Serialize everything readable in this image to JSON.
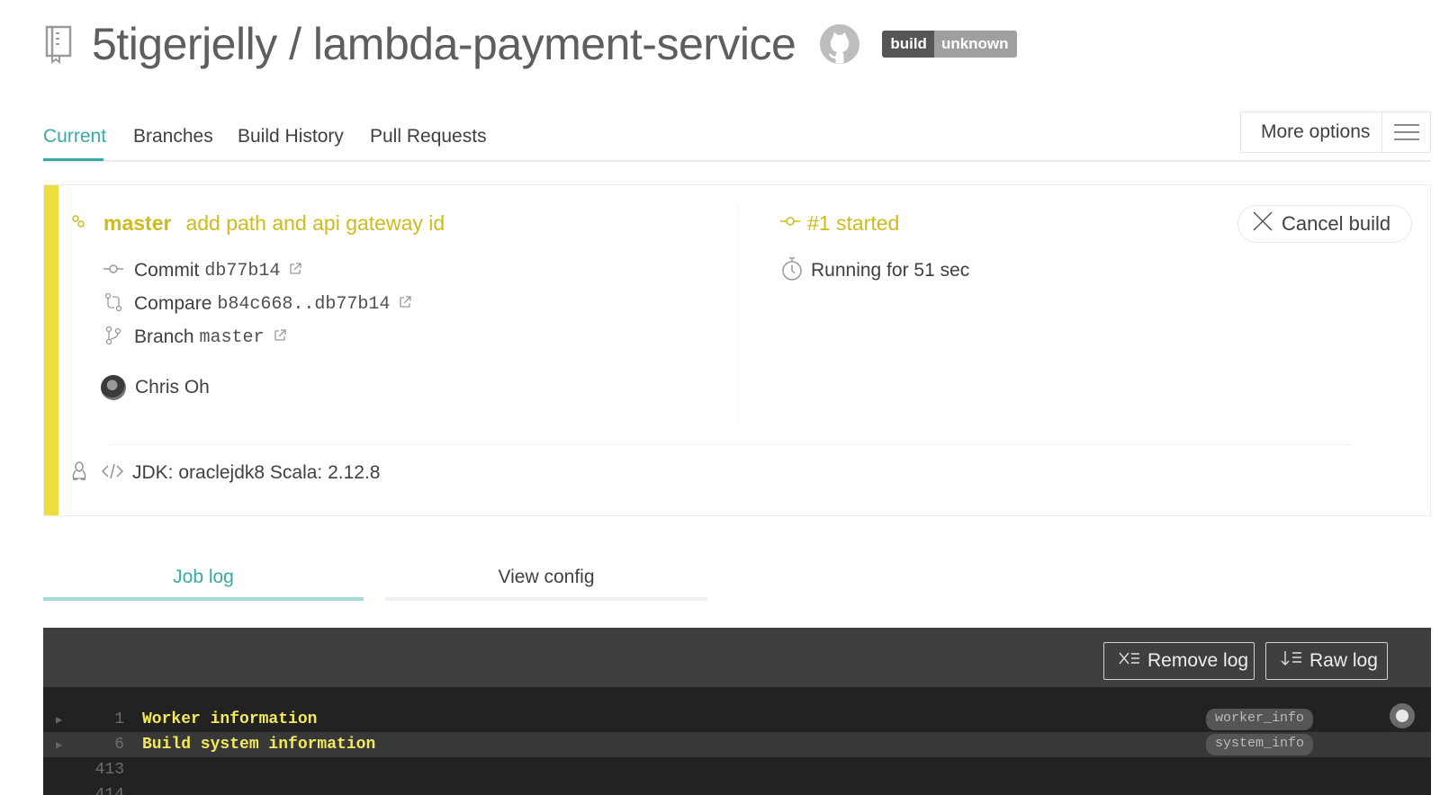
{
  "header": {
    "repo_title": "5tigerjelly / lambda-payment-service",
    "badge_left": "build",
    "badge_right": "unknown"
  },
  "nav": {
    "tabs": [
      "Current",
      "Branches",
      "Build History",
      "Pull Requests"
    ],
    "active_tab": "Current",
    "more_options": "More options"
  },
  "build": {
    "branch": "master",
    "commit_message": "add path and api gateway id",
    "status": "#1 started",
    "cancel_label": "Cancel build",
    "commit_label": "Commit",
    "commit_sha": "db77b14",
    "compare_label": "Compare",
    "compare_range": "b84c668..db77b14",
    "branch_label": "Branch",
    "branch_value": "master",
    "author": "Chris Oh",
    "running": "Running for 51 sec",
    "env": "JDK: oraclejdk8 Scala: 2.12.8",
    "status_color": "#cdbc1c"
  },
  "log_tabs": {
    "job_log": "Job log",
    "view_config": "View config"
  },
  "log": {
    "remove_label": "Remove log",
    "raw_label": "Raw log",
    "lines": [
      {
        "num": "1",
        "text": "Worker information",
        "tag": "worker_info"
      },
      {
        "num": "6",
        "text": "Build system information",
        "tag": "system_info"
      },
      {
        "num": "413",
        "text": "",
        "tag": ""
      },
      {
        "num": "414",
        "text": "",
        "tag": ""
      }
    ]
  },
  "colors": {
    "accent": "#39aaa4",
    "started": "#edde3f"
  }
}
